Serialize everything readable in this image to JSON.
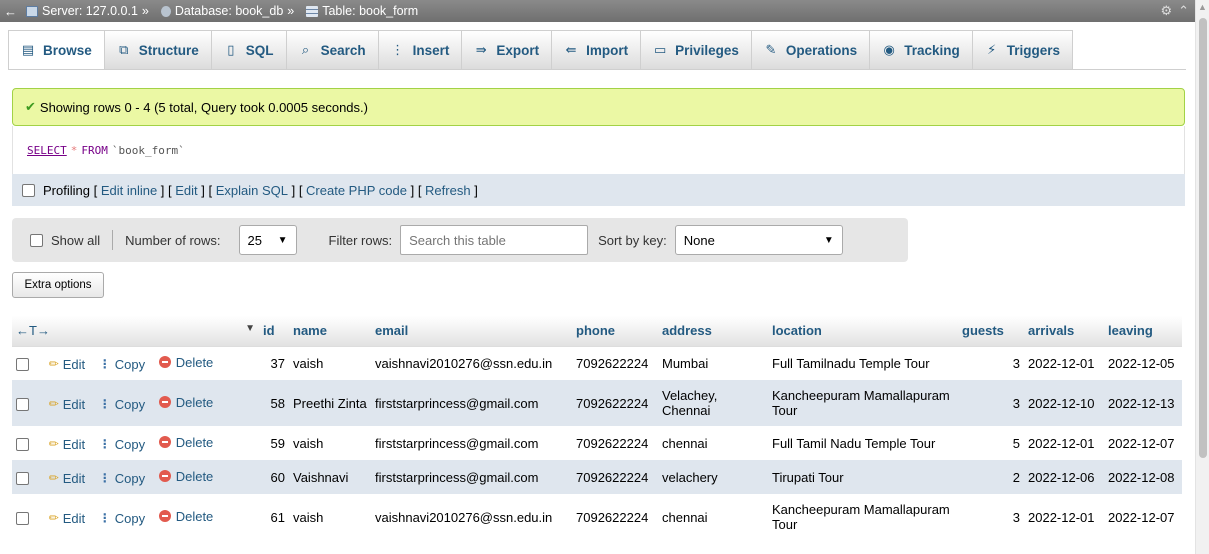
{
  "breadcrumb": {
    "server": "Server: 127.0.0.1",
    "database": "Database: book_db",
    "table": "Table: book_form",
    "separator": "»"
  },
  "tabs": [
    {
      "label": "Browse",
      "icon": "browse-icon"
    },
    {
      "label": "Structure",
      "icon": "structure-icon"
    },
    {
      "label": "SQL",
      "icon": "sql-icon"
    },
    {
      "label": "Search",
      "icon": "search-icon"
    },
    {
      "label": "Insert",
      "icon": "insert-icon"
    },
    {
      "label": "Export",
      "icon": "export-icon"
    },
    {
      "label": "Import",
      "icon": "import-icon"
    },
    {
      "label": "Privileges",
      "icon": "privileges-icon"
    },
    {
      "label": "Operations",
      "icon": "operations-icon"
    },
    {
      "label": "Tracking",
      "icon": "tracking-icon"
    },
    {
      "label": "Triggers",
      "icon": "triggers-icon"
    }
  ],
  "message": "Showing rows 0 - 4 (5 total, Query took 0.0005 seconds.)",
  "sql": {
    "select": "SELECT",
    "star": "*",
    "from": "FROM",
    "table": "`book_form`"
  },
  "profiling": {
    "label": "Profiling",
    "links": [
      "Edit inline",
      "Edit",
      "Explain SQL",
      "Create PHP code",
      "Refresh"
    ]
  },
  "nav": {
    "show_all": "Show all",
    "rows_label": "Number of rows:",
    "rows_value": "25",
    "filter_label": "Filter rows:",
    "filter_placeholder": "Search this table",
    "sort_label": "Sort by key:",
    "sort_value": "None"
  },
  "extra_options": "Extra options",
  "table": {
    "arrows": "←T→",
    "columns": [
      "id",
      "name",
      "email",
      "phone",
      "address",
      "location",
      "guests",
      "arrivals",
      "leaving"
    ],
    "actions": {
      "edit": "Edit",
      "copy": "Copy",
      "delete": "Delete"
    },
    "rows": [
      {
        "id": "37",
        "name": "vaish",
        "email": "vaishnavi2010276@ssn.edu.in",
        "phone": "7092622224",
        "address": "Mumbai",
        "location": "Full Tamilnadu Temple Tour",
        "guests": "3",
        "arrivals": "2022-12-01",
        "leaving": "2022-12-05"
      },
      {
        "id": "58",
        "name": "Preethi Zinta",
        "email": "firststarprincess@gmail.com",
        "phone": "7092622224",
        "address": "Velachey, Chennai",
        "location": "Kancheepuram Mamallapuram Tour",
        "guests": "3",
        "arrivals": "2022-12-10",
        "leaving": "2022-12-13"
      },
      {
        "id": "59",
        "name": "vaish",
        "email": "firststarprincess@gmail.com",
        "phone": "7092622224",
        "address": "chennai",
        "location": "Full Tamil Nadu Temple Tour",
        "guests": "5",
        "arrivals": "2022-12-01",
        "leaving": "2022-12-07"
      },
      {
        "id": "60",
        "name": "Vaishnavi",
        "email": "firststarprincess@gmail.com",
        "phone": "7092622224",
        "address": "velachery",
        "location": "Tirupati Tour",
        "guests": "2",
        "arrivals": "2022-12-06",
        "leaving": "2022-12-08"
      },
      {
        "id": "61",
        "name": "vaish",
        "email": "vaishnavi2010276@ssn.edu.in",
        "phone": "7092622224",
        "address": "chennai",
        "location": "Kancheepuram Mamallapuram Tour",
        "guests": "3",
        "arrivals": "2022-12-01",
        "leaving": "2022-12-07"
      }
    ]
  },
  "colors": {
    "link": "#235a81",
    "success_bg": "#ebf8a4",
    "row_alt": "#dfe6ee"
  }
}
